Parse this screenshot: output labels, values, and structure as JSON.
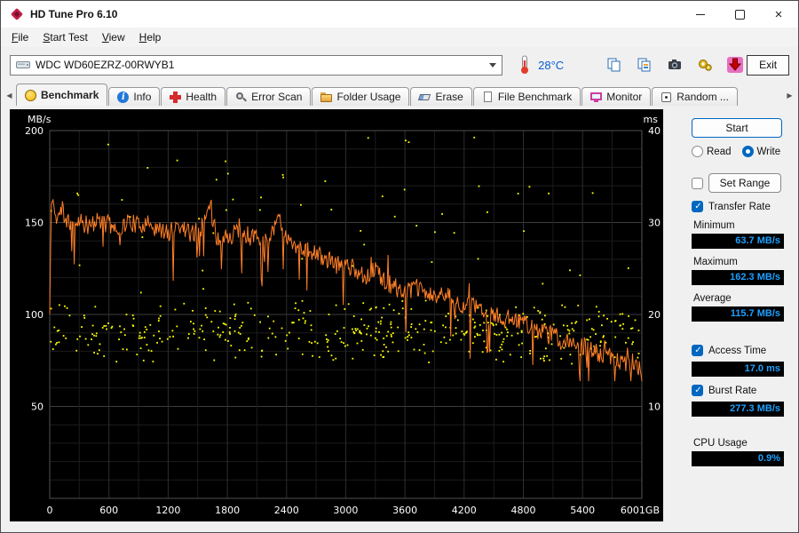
{
  "window": {
    "title": "HD Tune Pro 6.10"
  },
  "menu": {
    "items": [
      "File",
      "Start Test",
      "View",
      "Help"
    ]
  },
  "toolbar": {
    "drive": "WDC WD60EZRZ-00RWYB1",
    "temperature": "28°C",
    "buttons": [
      "copy",
      "copy-image",
      "screenshot",
      "settings",
      "save"
    ],
    "exit_label": "Exit"
  },
  "tabs": [
    {
      "label": "Benchmark",
      "icon": "benchmark",
      "active": true
    },
    {
      "label": "Info",
      "icon": "info",
      "active": false
    },
    {
      "label": "Health",
      "icon": "health",
      "active": false
    },
    {
      "label": "Error Scan",
      "icon": "error-scan",
      "active": false
    },
    {
      "label": "Folder Usage",
      "icon": "folder-usage",
      "active": false
    },
    {
      "label": "Erase",
      "icon": "erase",
      "active": false
    },
    {
      "label": "File Benchmark",
      "icon": "file-benchmark",
      "active": false
    },
    {
      "label": "Monitor",
      "icon": "monitor",
      "active": false
    },
    {
      "label": "Random ...",
      "icon": "random",
      "active": false
    }
  ],
  "sidebar": {
    "start_label": "Start",
    "read_label": "Read",
    "write_label": "Write",
    "read_selected": false,
    "write_selected": true,
    "set_range_label": "Set Range",
    "set_range_checked": false,
    "transfer_rate_label": "Transfer Rate",
    "transfer_rate_checked": true,
    "minimum_label": "Minimum",
    "minimum_value": "63.7 MB/s",
    "maximum_label": "Maximum",
    "maximum_value": "162.3 MB/s",
    "average_label": "Average",
    "average_value": "115.7 MB/s",
    "access_time_label": "Access Time",
    "access_time_checked": true,
    "access_time_value": "17.0 ms",
    "burst_rate_label": "Burst Rate",
    "burst_rate_checked": true,
    "burst_rate_value": "277.3 MB/s",
    "cpu_usage_label": "CPU Usage",
    "cpu_usage_value": "0.9%"
  },
  "colors": {
    "transfer_rate_line": "#ff7f27",
    "access_time_dots": "#ffff00",
    "stat_value_text": "#1ea0ff",
    "accent_blue": "#0067c0",
    "chart_background": "#000000",
    "temperature_text": "#0b5bd3"
  },
  "chart_data": {
    "type": "line",
    "x_axis": {
      "min": 0,
      "max": 6001,
      "tick_values": [
        0,
        600,
        1200,
        1800,
        2400,
        3000,
        3600,
        4200,
        4800,
        5400,
        6001
      ],
      "tick_labels": [
        "0",
        "600",
        "1200",
        "1800",
        "2400",
        "3000",
        "3600",
        "4200",
        "4800",
        "5400",
        "6001GB"
      ]
    },
    "y_left_axis": {
      "label": "MB/s",
      "min": 0,
      "max": 200,
      "tick_values": [
        200,
        150,
        100,
        50
      ]
    },
    "y_right_axis": {
      "label": "ms",
      "min": 0,
      "max": 40,
      "tick_values": [
        40,
        30,
        20,
        10
      ]
    },
    "grid": {
      "h_minor_step_mbs": 10,
      "v_minor_step_gb": 300
    },
    "series": [
      {
        "name": "Transfer Rate (write)",
        "axis": "left",
        "style": "line",
        "color": "#ff7f27",
        "unit": "MB/s",
        "trend_anchors_gb_mbs": [
          [
            0,
            100
          ],
          [
            12,
            150
          ],
          [
            25,
            166
          ],
          [
            60,
            152
          ],
          [
            120,
            156
          ],
          [
            200,
            148
          ],
          [
            300,
            152
          ],
          [
            400,
            147
          ],
          [
            500,
            151
          ],
          [
            600,
            149
          ],
          [
            700,
            146
          ],
          [
            800,
            151
          ],
          [
            900,
            148
          ],
          [
            1000,
            150
          ],
          [
            1100,
            146
          ],
          [
            1200,
            144
          ],
          [
            1300,
            149
          ],
          [
            1400,
            145
          ],
          [
            1500,
            143
          ],
          [
            1620,
            158
          ],
          [
            1700,
            141
          ],
          [
            1800,
            142
          ],
          [
            1900,
            145
          ],
          [
            2000,
            140
          ],
          [
            2100,
            143
          ],
          [
            2200,
            139
          ],
          [
            2320,
            154
          ],
          [
            2400,
            141
          ],
          [
            2500,
            138
          ],
          [
            2600,
            135
          ],
          [
            2700,
            133
          ],
          [
            2800,
            130
          ],
          [
            2900,
            127
          ],
          [
            3000,
            128
          ],
          [
            3100,
            124
          ],
          [
            3200,
            121
          ],
          [
            3300,
            125
          ],
          [
            3400,
            118
          ],
          [
            3500,
            115
          ],
          [
            3600,
            111
          ],
          [
            3700,
            115
          ],
          [
            3800,
            112
          ],
          [
            3900,
            109
          ],
          [
            4000,
            112
          ],
          [
            4100,
            107
          ],
          [
            4200,
            105
          ],
          [
            4300,
            104
          ],
          [
            4400,
            101
          ],
          [
            4500,
            100
          ],
          [
            4600,
            97
          ],
          [
            4700,
            99
          ],
          [
            4800,
            96
          ],
          [
            4900,
            92
          ],
          [
            5000,
            90
          ],
          [
            5100,
            89
          ],
          [
            5200,
            86
          ],
          [
            5300,
            85
          ],
          [
            5400,
            83
          ],
          [
            5500,
            80
          ],
          [
            5600,
            78
          ],
          [
            5700,
            75
          ],
          [
            5800,
            74
          ],
          [
            5900,
            70
          ],
          [
            6001,
            71
          ]
        ],
        "noise": {
          "seed": 11,
          "samples": 700,
          "jitter": 5,
          "down_spike_prob": 0.05,
          "down_spike_min": 8,
          "down_spike_max": 26,
          "up_spike_prob": 0.03,
          "up_spike_max": 12,
          "clamp_min": 63.7,
          "clamp_max": 162.3
        }
      },
      {
        "name": "Access Time",
        "axis": "right",
        "style": "scatter",
        "color": "#ffff00",
        "unit": "ms",
        "generator": {
          "seed": 7,
          "count": 460,
          "band_ms": [
            14.5,
            21.8
          ],
          "outlier_count": 55,
          "outlier_band_ms": [
            22,
            39.5
          ]
        }
      }
    ],
    "stats": {
      "minimum_mbs": 63.7,
      "maximum_mbs": 162.3,
      "average_mbs": 115.7,
      "access_time_ms": 17.0,
      "burst_rate_mbs": 277.3,
      "cpu_usage_percent": 0.9
    }
  }
}
